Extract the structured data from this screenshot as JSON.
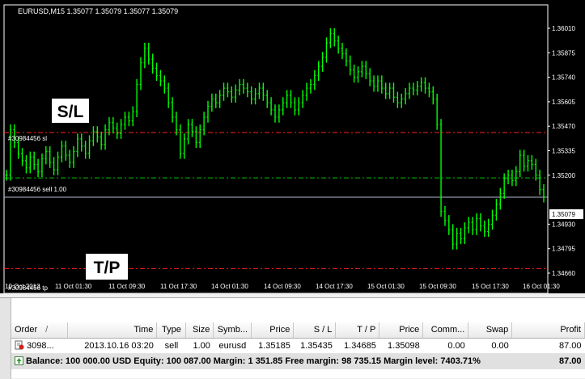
{
  "chart": {
    "title": "EURUSD,M15  1.35077 1.35079 1.35077 1.35079",
    "current_price": "1.35079",
    "price_axis_labels": [
      "1.36010",
      "1.35875",
      "1.35740",
      "1.35605",
      "1.35470",
      "1.35335",
      "1.35200",
      "1.35079",
      "1.34930",
      "1.34795",
      "1.34660"
    ],
    "time_axis_labels": [
      "10 Oct 2013",
      "11 Oct 01:30",
      "11 Oct 09:30",
      "11 Oct 17:30",
      "14 Oct 01:30",
      "14 Oct 09:30",
      "14 Oct 17:30",
      "15 Oct 01:30",
      "15 Oct 09:30",
      "15 Oct 17:30",
      "16 Oct 01:30"
    ],
    "lines": {
      "sl_label": "#30984456 sl",
      "entry_label": "#30984456 sell 1.00",
      "tp_label": "#30984456 tp"
    },
    "annotations": {
      "sl": "S/L",
      "tp": "T/P"
    },
    "colors": {
      "candles": "#00ff00",
      "sl_line": "#ff2020",
      "entry_line": "#00c800",
      "bid_line": "#aeb8c8",
      "grid": "#ffffff"
    },
    "price_series": [
      1.352,
      1.3545,
      1.3538,
      1.3532,
      1.3528,
      1.3524,
      1.353,
      1.3526,
      1.3522,
      1.3529,
      1.3533,
      1.3527,
      1.3523,
      1.353,
      1.3536,
      1.3531,
      1.3527,
      1.3533,
      1.354,
      1.3536,
      1.3532,
      1.3539,
      1.3544,
      1.3541,
      1.3537,
      1.3545,
      1.3549,
      1.3546,
      1.3543,
      1.3548,
      1.3552,
      1.355,
      1.3555,
      1.357,
      1.3582,
      1.359,
      1.3584,
      1.3579,
      1.3575,
      1.3572,
      1.3568,
      1.356,
      1.3552,
      1.3545,
      1.3532,
      1.354,
      1.3548,
      1.3544,
      1.3538,
      1.3545,
      1.3552,
      1.3558,
      1.3562,
      1.356,
      1.3564,
      1.3568,
      1.3566,
      1.3563,
      1.3567,
      1.357,
      1.3568,
      1.3566,
      1.3562,
      1.3565,
      1.3568,
      1.3564,
      1.356,
      1.3556,
      1.3552,
      1.3556,
      1.356,
      1.3564,
      1.356,
      1.3556,
      1.356,
      1.3564,
      1.3568,
      1.357,
      1.3575,
      1.358,
      1.3585,
      1.3593,
      1.3598,
      1.3594,
      1.359,
      1.3587,
      1.3583,
      1.3578,
      1.3574,
      1.3577,
      1.358,
      1.3576,
      1.3572,
      1.3569,
      1.3572,
      1.3568,
      1.3565,
      1.3568,
      1.3563,
      1.356,
      1.3562,
      1.3565,
      1.3568,
      1.3567,
      1.3569,
      1.3571,
      1.3568,
      1.3566,
      1.3562,
      1.3548,
      1.35,
      1.3495,
      1.349,
      1.3482,
      1.3488,
      1.3485,
      1.3491,
      1.3494,
      1.349,
      1.3496,
      1.3492,
      1.3489,
      1.3493,
      1.3498,
      1.3504,
      1.351,
      1.3518,
      1.352,
      1.3517,
      1.3522,
      1.3531,
      1.3525,
      1.3528,
      1.3526,
      1.352,
      1.3512,
      1.3508
    ]
  },
  "terminal": {
    "columns": [
      {
        "label": "Order",
        "align": "l"
      },
      {
        "label": "Time",
        "align": "r"
      },
      {
        "label": "Type",
        "align": "c"
      },
      {
        "label": "Size",
        "align": "r"
      },
      {
        "label": "Symb...",
        "align": "c"
      },
      {
        "label": "Price",
        "align": "r"
      },
      {
        "label": "S / L",
        "align": "r"
      },
      {
        "label": "T / P",
        "align": "r"
      },
      {
        "label": "Price",
        "align": "r"
      },
      {
        "label": "Comm...",
        "align": "r"
      },
      {
        "label": "Swap",
        "align": "r"
      },
      {
        "label": "Profit",
        "align": "r"
      }
    ],
    "sort_indicator": "/",
    "rows": [
      {
        "order": "3098...",
        "time": "2013.10.16 03:20",
        "type": "sell",
        "size": "1.00",
        "symbol": "eurusd",
        "price": "1.35185",
        "sl": "1.35435",
        "tp": "1.34685",
        "cur_price": "1.35098",
        "commission": "0.00",
        "swap": "0.00",
        "profit": "87.00"
      }
    ],
    "balance": {
      "text": "Balance: 100 000.00 USD  Equity: 100 087.00  Margin: 1 351.85  Free margin: 98 735.15  Margin level: 7403.71%",
      "profit": "87.00"
    }
  }
}
